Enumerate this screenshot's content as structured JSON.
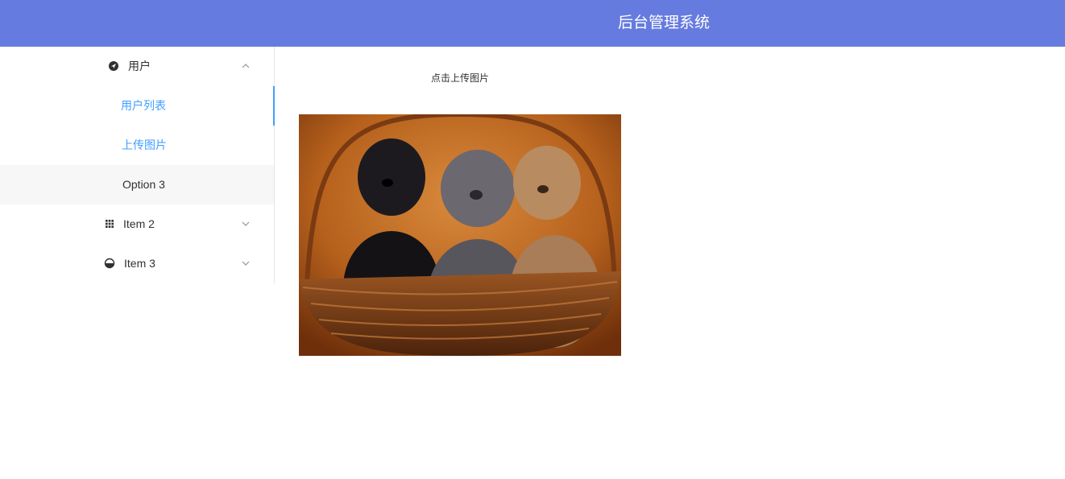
{
  "header": {
    "title": "后台管理系统"
  },
  "sidebar": {
    "groups": [
      {
        "label": "用户",
        "icon": "location-icon",
        "expanded": true,
        "items": [
          {
            "label": "用户列表",
            "active": true
          },
          {
            "label": "上传图片",
            "active": false
          },
          {
            "label": "Option 3",
            "active": false
          }
        ]
      },
      {
        "label": "Item 2",
        "icon": "grid-icon",
        "expanded": false
      },
      {
        "label": "Item 3",
        "icon": "half-circle-icon",
        "expanded": false
      }
    ]
  },
  "main": {
    "upload_label": "点击上传图片",
    "image": {
      "subject": "puppies-in-basket"
    }
  },
  "colors": {
    "header_bg": "#667bdf",
    "accent": "#409eff",
    "text": "#303133"
  }
}
